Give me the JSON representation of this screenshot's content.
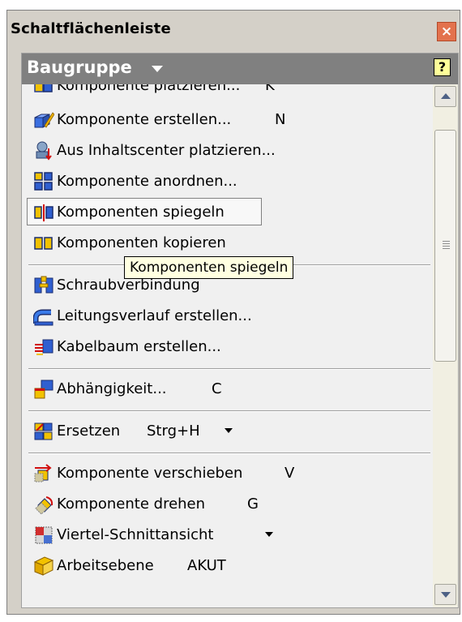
{
  "window": {
    "title": "Schaltflächenleiste",
    "close_glyph": "×"
  },
  "panel": {
    "header_title": "Baugruppe",
    "help_glyph": "?"
  },
  "items": [
    {
      "label": "Komponente platzieren...",
      "shortcut": "K",
      "icon": "place-component-icon"
    },
    {
      "label": "Komponente erstellen...",
      "shortcut": "N",
      "icon": "create-component-icon"
    },
    {
      "label": "Aus Inhaltscenter platzieren...",
      "shortcut": "",
      "icon": "content-center-icon"
    },
    {
      "label": "Komponente anordnen...",
      "shortcut": "",
      "icon": "pattern-component-icon"
    },
    {
      "label": "Komponenten spiegeln",
      "shortcut": "",
      "icon": "mirror-components-icon",
      "state": "pressed"
    },
    {
      "label": "Komponenten kopieren",
      "shortcut": "",
      "icon": "copy-components-icon"
    },
    {
      "label": "Schraubverbindung",
      "shortcut": "",
      "icon": "bolted-connection-icon"
    },
    {
      "label": "Leitungsverlauf erstellen...",
      "shortcut": "",
      "icon": "create-route-icon"
    },
    {
      "label": "Kabelbaum erstellen...",
      "shortcut": "",
      "icon": "create-harness-icon"
    },
    {
      "label": "Abhängigkeit...",
      "shortcut": "C",
      "icon": "constraint-icon"
    },
    {
      "label": "Ersetzen",
      "shortcut": "Strg+H",
      "icon": "replace-icon",
      "has_dropdown": true
    },
    {
      "label": "Komponente verschieben",
      "shortcut": "V",
      "icon": "move-component-icon"
    },
    {
      "label": "Komponente drehen",
      "shortcut": "G",
      "icon": "rotate-component-icon"
    },
    {
      "label": "Viertel-Schnittansicht",
      "shortcut": "",
      "icon": "quarter-section-view-icon",
      "has_dropdown": true
    },
    {
      "label": "Arbeitsebene",
      "shortcut": "AKUT",
      "icon": "work-plane-icon"
    }
  ],
  "tooltip": {
    "text": "Komponenten spiegeln"
  },
  "colors": {
    "header_bg": "#808080",
    "close_bg": "#e3724e",
    "tooltip_bg": "#ffffe1",
    "help_bg": "#ffff99"
  }
}
